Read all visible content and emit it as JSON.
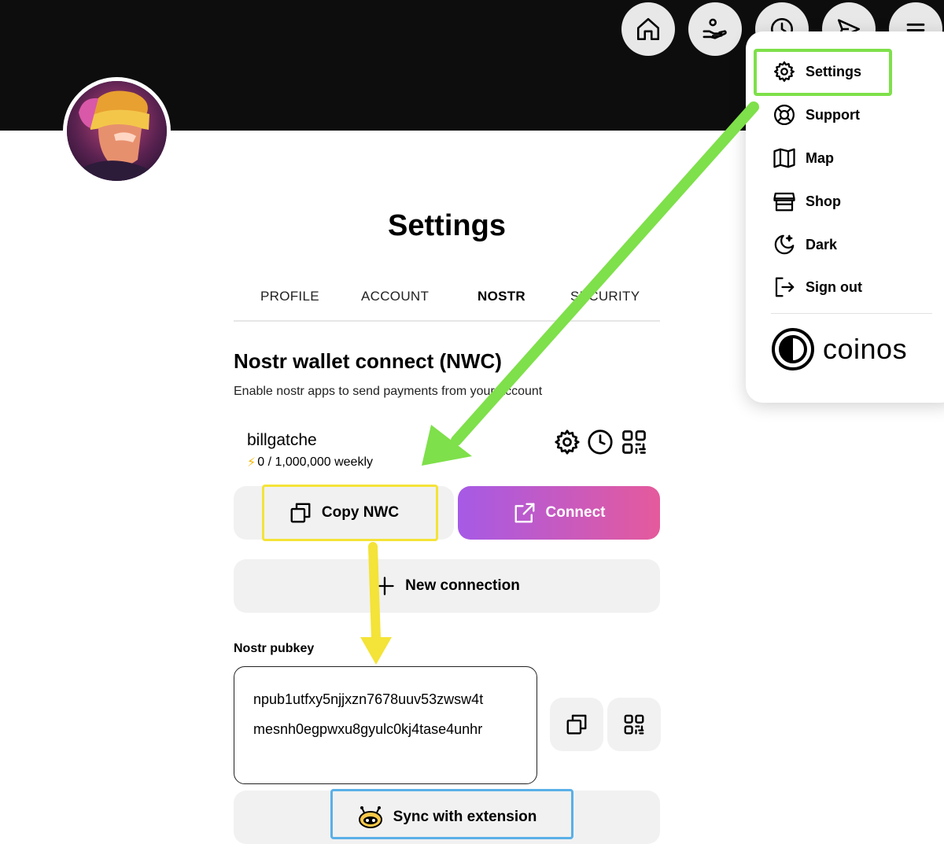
{
  "nav": {
    "icons": [
      "home-icon",
      "hand-coins-icon",
      "clock-icon",
      "send-icon",
      "menu-icon"
    ]
  },
  "page": {
    "title": "Settings"
  },
  "tabs": [
    {
      "label": "PROFILE",
      "active": false
    },
    {
      "label": "ACCOUNT",
      "active": false
    },
    {
      "label": "NOSTR",
      "active": true
    },
    {
      "label": "SECURITY",
      "active": false
    }
  ],
  "nwc": {
    "title": "Nostr wallet connect (NWC)",
    "description": "Enable nostr apps to send payments from your account",
    "connection": {
      "name": "billgatche",
      "budget": "0 / 1,000,000 weekly"
    },
    "copy_label": "Copy NWC",
    "connect_label": "Connect",
    "new_connection_label": "New connection"
  },
  "pubkey": {
    "label": "Nostr pubkey",
    "line1": "npub1utfxy5njjxzn7678uuv53zwsw4t",
    "line2": "mesnh0egpwxu8gyulc0kj4tase4unhr"
  },
  "sync_label": "Sync with extension",
  "menu": {
    "items": [
      {
        "label": "Settings",
        "icon": "gear-icon"
      },
      {
        "label": "Support",
        "icon": "lifebuoy-icon"
      },
      {
        "label": "Map",
        "icon": "map-icon"
      },
      {
        "label": "Shop",
        "icon": "store-icon"
      },
      {
        "label": "Dark",
        "icon": "moon-stars-icon"
      },
      {
        "label": "Sign out",
        "icon": "sign-out-icon"
      }
    ],
    "brand": "coinos"
  },
  "colors": {
    "header": "#0d0d0d",
    "connect_gradient_start": "#a65ae6",
    "connect_gradient_end": "#e55a9c",
    "highlight_green": "#7ee04a",
    "highlight_yellow": "#f4e338",
    "highlight_blue": "#5ab0e8",
    "bolt": "#f5b800"
  }
}
